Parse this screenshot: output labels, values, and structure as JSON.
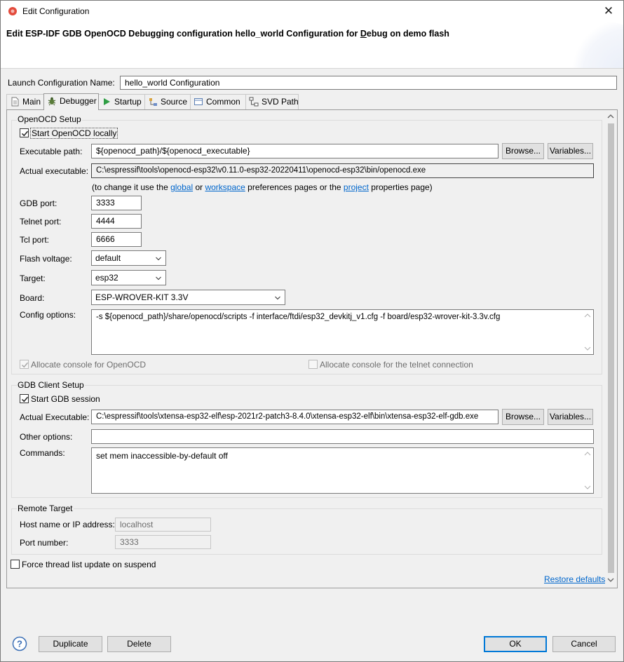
{
  "window": {
    "title": "Edit Configuration",
    "close_glyph": "✕"
  },
  "header": {
    "title_pre": "Edit ESP-IDF GDB OpenOCD Debugging configuration hello_world Configuration for ",
    "title_mnemonic": "D",
    "title_rest": "ebug on demo flash"
  },
  "launch_name": {
    "label": "Launch Configuration Name:",
    "value": "hello_world Configuration"
  },
  "tabs": [
    {
      "label": "Main",
      "icon": "document-icon"
    },
    {
      "label": "Debugger",
      "icon": "bug-icon"
    },
    {
      "label": "Startup",
      "icon": "play-icon"
    },
    {
      "label": "Source",
      "icon": "source-icon"
    },
    {
      "label": "Common",
      "icon": "common-icon"
    },
    {
      "label": "SVD Path",
      "icon": "svd-icon"
    }
  ],
  "openocd": {
    "group_label": "OpenOCD Setup",
    "start_locally_label": "Start OpenOCD locally",
    "start_locally_checked": true,
    "exec_path_label": "Executable path:",
    "exec_path_value": "${openocd_path}/${openocd_executable}",
    "browse_label": "Browse...",
    "variables_label": "Variables...",
    "actual_exec_label": "Actual executable:",
    "actual_exec_value": "C:\\espressif\\tools\\openocd-esp32\\v0.11.0-esp32-20220411\\openocd-esp32\\bin/openocd.exe",
    "hint_prefix": "(to change it use the ",
    "hint_link_global": "global",
    "hint_or": " or ",
    "hint_link_workspace": "workspace",
    "hint_mid": " preferences pages or the ",
    "hint_link_project": "project",
    "hint_suffix": " properties page)",
    "gdb_port_label": "GDB port:",
    "gdb_port_value": "3333",
    "telnet_port_label": "Telnet port:",
    "telnet_port_value": "4444",
    "tcl_port_label": "Tcl port:",
    "tcl_port_value": "6666",
    "flash_voltage_label": "Flash voltage:",
    "flash_voltage_value": "default",
    "target_label": "Target:",
    "target_value": "esp32",
    "board_label": "Board:",
    "board_value": "ESP-WROVER-KIT 3.3V",
    "config_options_label": "Config options:",
    "config_options_value": "-s ${openocd_path}/share/openocd/scripts -f interface/ftdi/esp32_devkitj_v1.cfg -f board/esp32-wrover-kit-3.3v.cfg",
    "alloc_console_label": "Allocate console for OpenOCD",
    "alloc_console_checked": true,
    "alloc_telnet_label": "Allocate console for the telnet connection",
    "alloc_telnet_checked": false
  },
  "gdb": {
    "group_label": "GDB Client Setup",
    "start_session_label": "Start GDB session",
    "start_session_checked": true,
    "actual_exec_label": "Actual Executable:",
    "actual_exec_value": "C:\\espressif\\tools\\xtensa-esp32-elf\\esp-2021r2-patch3-8.4.0\\xtensa-esp32-elf\\bin\\xtensa-esp32-elf-gdb.exe",
    "browse_label": "Browse...",
    "variables_label": "Variables...",
    "other_options_label": "Other options:",
    "other_options_value": "",
    "commands_label": "Commands:",
    "commands_value": "set mem inaccessible-by-default off"
  },
  "remote": {
    "group_label": "Remote Target",
    "host_label": "Host name or IP address:",
    "host_value": "localhost",
    "port_label": "Port number:",
    "port_value": "3333"
  },
  "force_thread_label": "Force thread list update on suspend",
  "force_thread_checked": false,
  "restore_defaults_label": "Restore defaults",
  "footer": {
    "duplicate_label": "Duplicate",
    "delete_label": "Delete",
    "ok_label": "OK",
    "cancel_label": "Cancel"
  },
  "colors": {
    "link": "#0066cc",
    "primary_border": "#0078d7"
  }
}
